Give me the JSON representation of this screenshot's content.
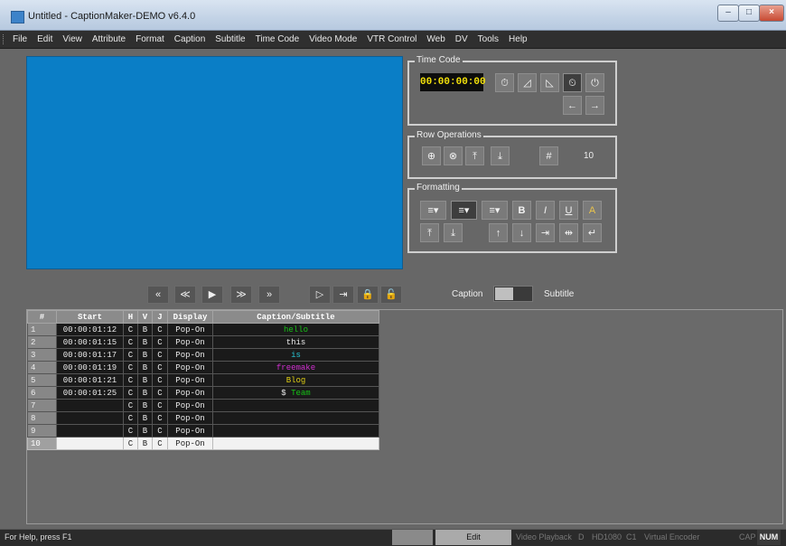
{
  "window": {
    "title": "Untitled - CaptionMaker-DEMO v6.4.0",
    "btn_min": "–",
    "btn_max": "□",
    "btn_close": "×"
  },
  "menu": [
    "File",
    "Edit",
    "View",
    "Attribute",
    "Format",
    "Caption",
    "Subtitle",
    "Time Code",
    "Video Mode",
    "VTR Control",
    "Web",
    "DV",
    "Tools",
    "Help"
  ],
  "timecode": {
    "title": "Time Code",
    "value": "00:00:00:00",
    "icons": {
      "set": "⏱",
      "ramp_in": "◿",
      "ramp_out": "◺",
      "clock_a": "⏲",
      "clock_b": "⏻",
      "prev": "←",
      "next": "→"
    }
  },
  "row_ops": {
    "title": "Row Operations",
    "icons": {
      "add": "⊕",
      "delete": "⊗",
      "insert_above": "⤒",
      "insert_below": "⤓",
      "number": "#"
    },
    "count": "10"
  },
  "formatting": {
    "title": "Formatting",
    "icons": {
      "align_left": "≡▾",
      "align_center": "≡▾",
      "align_right": "≡▾",
      "bold": "B",
      "italic": "I",
      "underline": "U",
      "color": "A",
      "top": "⤒",
      "bottom": "⤓",
      "up": "↑",
      "down": "↓",
      "indent_in": "⇥",
      "indent_out": "⇹",
      "return": "↵"
    }
  },
  "transport": {
    "rewind": "«",
    "back": "≪",
    "play": "▶",
    "fwd": "≫",
    "end": "»",
    "mark_in": "▷",
    "mark_out": "⇥",
    "lock_a": "🔒",
    "lock_b": "🔓"
  },
  "mode": {
    "caption_label": "Caption",
    "subtitle_label": "Subtitle"
  },
  "grid": {
    "headers": [
      "#",
      "Start",
      "H",
      "V",
      "J",
      "Display",
      "Caption/Subtitle"
    ],
    "rows": [
      {
        "n": "1",
        "start": "00:00:01:12",
        "h": "C",
        "v": "B",
        "j": "C",
        "display": "Pop-On",
        "text": "hello",
        "color": "#16c216"
      },
      {
        "n": "2",
        "start": "00:00:01:15",
        "h": "C",
        "v": "B",
        "j": "C",
        "display": "Pop-On",
        "text": "this",
        "color": "#eaeaea"
      },
      {
        "n": "3",
        "start": "00:00:01:17",
        "h": "C",
        "v": "B",
        "j": "C",
        "display": "Pop-On",
        "text": "is",
        "color": "#27c4d4"
      },
      {
        "n": "4",
        "start": "00:00:01:19",
        "h": "C",
        "v": "B",
        "j": "C",
        "display": "Pop-On",
        "text": "freemake",
        "color": "#d02fd0"
      },
      {
        "n": "5",
        "start": "00:00:01:21",
        "h": "C",
        "v": "B",
        "j": "C",
        "display": "Pop-On",
        "text": "Blog",
        "color": "#e0cf14"
      },
      {
        "n": "6",
        "start": "00:00:01:25",
        "h": "C",
        "v": "B",
        "j": "C",
        "display": "Pop-On",
        "text_prefix": "$ ",
        "text": "Team",
        "color": "#16c216"
      },
      {
        "n": "7",
        "start": "",
        "h": "C",
        "v": "B",
        "j": "C",
        "display": "Pop-On",
        "text": "",
        "color": "#eaeaea"
      },
      {
        "n": "8",
        "start": "",
        "h": "C",
        "v": "B",
        "j": "C",
        "display": "Pop-On",
        "text": "",
        "color": "#eaeaea"
      },
      {
        "n": "9",
        "start": "",
        "h": "C",
        "v": "B",
        "j": "C",
        "display": "Pop-On",
        "text": "",
        "color": "#eaeaea"
      },
      {
        "n": "10",
        "start": "",
        "h": "C",
        "v": "B",
        "j": "C",
        "display": "Pop-On",
        "text": "",
        "color": "#222222"
      }
    ]
  },
  "status": {
    "help": "For Help, press F1",
    "mode": "Edit",
    "playback": "Video Playback",
    "d": "D",
    "format": "HD1080",
    "c1": "C1",
    "encoder": "Virtual Encoder",
    "cap": "CAP",
    "num": "NUM"
  }
}
